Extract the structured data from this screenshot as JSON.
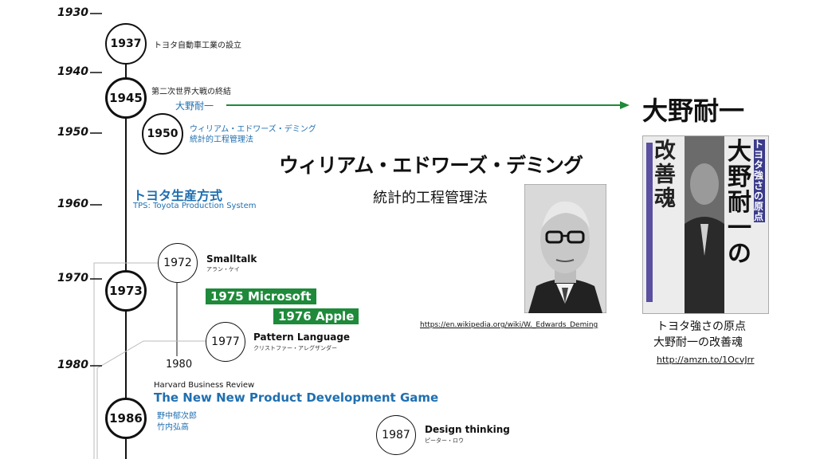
{
  "timeline": {
    "decades": [
      "1930",
      "1940",
      "1950",
      "1960",
      "1970",
      "1980"
    ],
    "events": [
      {
        "year": "1937",
        "label": "トヨタ自動車工業の設立"
      },
      {
        "year": "1945",
        "label": "第二次世界大戦の終結",
        "sub": "大野耐一"
      },
      {
        "year": "1950",
        "label": "ウィリアム・エドワーズ・デミング",
        "sub": "統計的工程管理法"
      },
      {
        "year": "1972",
        "label": "Smalltalk",
        "sub": "アラン・ケイ"
      },
      {
        "year": "1973"
      },
      {
        "year": "1977",
        "label": "Pattern Language",
        "sub": "クリストファー・アレグザンダー"
      },
      {
        "year": "1986",
        "label": "The New New Product Development Game",
        "overline": "Harvard Business Review",
        "authors": [
          "野中郁次郎",
          "竹内弘高"
        ]
      },
      {
        "year": "1987",
        "label": "Design thinking",
        "sub": "ピーター・ロウ"
      }
    ],
    "branch_year": "1980"
  },
  "tps": {
    "title": "トヨタ生産方式",
    "subtitle": "TPS: Toyota Production System"
  },
  "badges": {
    "microsoft": "1975 Microsoft",
    "apple": "1976 Apple"
  },
  "deming": {
    "title": "ウィリアム・エドワーズ・デミング",
    "subtitle": "統計的工程管理法",
    "url": "https://en.wikipedia.org/wiki/W._Edwards_Deming"
  },
  "ohno": {
    "title": "大野耐一",
    "book_title": "トヨタ強さの原点",
    "book_subtitle": "大野耐一の改善魂",
    "url": "http://amzn.to/1OcvJrr",
    "cover_vertical_title": "大野耐一の",
    "cover_banner": "トヨタ強さの原点",
    "cover_left": "改善魂"
  },
  "colors": {
    "arrow": "#1e8a3a",
    "accent_blue": "#1f6fb0",
    "badge_green": "#1e8a3a"
  }
}
